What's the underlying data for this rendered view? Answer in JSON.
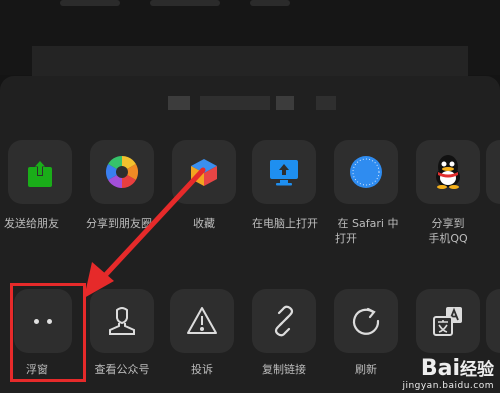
{
  "share_row": [
    {
      "icon": "send-icon",
      "label": "发送给朋友"
    },
    {
      "icon": "moments-icon",
      "label": "分享到朋友圈"
    },
    {
      "icon": "favorites-icon",
      "label": "收藏"
    },
    {
      "icon": "computer-icon",
      "label": "在电脑上打开"
    },
    {
      "icon": "safari-icon",
      "label_line1": "在 Safari 中",
      "label_line2": "打开"
    },
    {
      "icon": "qq-icon",
      "label_line1": "分享到",
      "label_line2": "手机QQ"
    }
  ],
  "action_row": [
    {
      "icon": "float-window-icon",
      "label": "浮窗"
    },
    {
      "icon": "official-account-icon",
      "label": "查看公众号"
    },
    {
      "icon": "warning-icon",
      "label": "投诉"
    },
    {
      "icon": "link-icon",
      "label": "复制链接"
    },
    {
      "icon": "refresh-icon",
      "label": "刷新"
    },
    {
      "icon": "translate-icon",
      "label": ""
    }
  ],
  "annotation": {
    "color": "#e62a2a",
    "target": "浮窗"
  },
  "watermark": {
    "brand": "Bai",
    "brand_cn": "经验",
    "url": "jingyan.baidu.com"
  },
  "colors": {
    "sheet": "#202020",
    "tile": "#2e2e2e",
    "green": "#1aad19",
    "blue": "#1e8ff0"
  }
}
